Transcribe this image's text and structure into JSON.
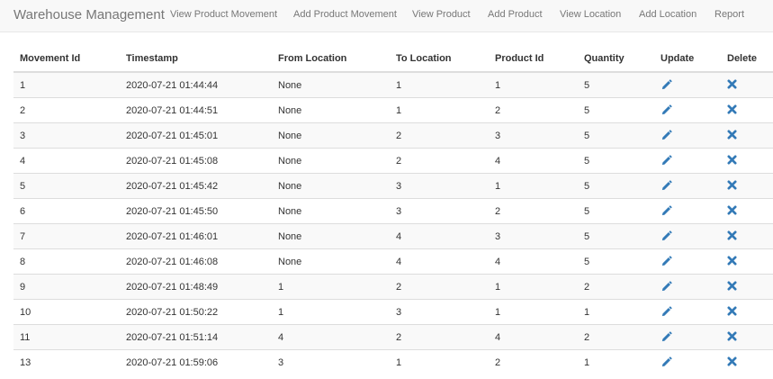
{
  "navbar": {
    "brand": "Warehouse Management",
    "links": [
      "View Product Movement",
      "Add Product Movement",
      "View Product",
      "Add Product",
      "View Location",
      "Add Location",
      "Report"
    ]
  },
  "table": {
    "headers": [
      "Movement Id",
      "Timestamp",
      "From Location",
      "To Location",
      "Product Id",
      "Quantity",
      "Update",
      "Delete"
    ],
    "rows": [
      [
        "1",
        "2020-07-21 01:44:44",
        "None",
        "1",
        "1",
        "5"
      ],
      [
        "2",
        "2020-07-21 01:44:51",
        "None",
        "1",
        "2",
        "5"
      ],
      [
        "3",
        "2020-07-21 01:45:01",
        "None",
        "2",
        "3",
        "5"
      ],
      [
        "4",
        "2020-07-21 01:45:08",
        "None",
        "2",
        "4",
        "5"
      ],
      [
        "5",
        "2020-07-21 01:45:42",
        "None",
        "3",
        "1",
        "5"
      ],
      [
        "6",
        "2020-07-21 01:45:50",
        "None",
        "3",
        "2",
        "5"
      ],
      [
        "7",
        "2020-07-21 01:46:01",
        "None",
        "4",
        "3",
        "5"
      ],
      [
        "8",
        "2020-07-21 01:46:08",
        "None",
        "4",
        "4",
        "5"
      ],
      [
        "9",
        "2020-07-21 01:48:49",
        "1",
        "2",
        "1",
        "2"
      ],
      [
        "10",
        "2020-07-21 01:50:22",
        "1",
        "3",
        "1",
        "1"
      ],
      [
        "11",
        "2020-07-21 01:51:14",
        "4",
        "2",
        "4",
        "2"
      ],
      [
        "13",
        "2020-07-21 01:59:06",
        "3",
        "1",
        "2",
        "1"
      ]
    ]
  },
  "icons": {
    "update": "pencil-icon",
    "delete": "remove-icon"
  },
  "colors": {
    "icon": "#337ab7",
    "navbar_bg": "#f8f8f8",
    "nav_text": "#777777",
    "stripe": "#f9f9f9"
  }
}
